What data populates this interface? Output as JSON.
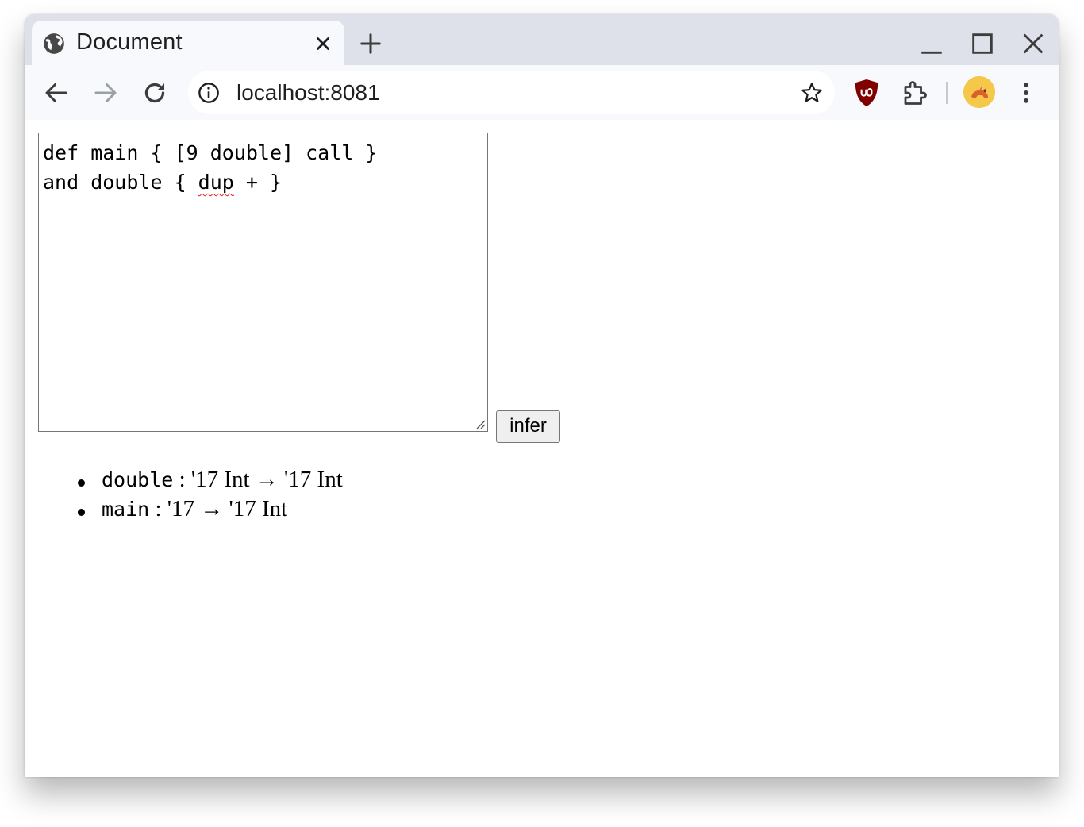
{
  "browser": {
    "tab": {
      "title": "Document",
      "favicon": "globe-icon",
      "close_icon": "close-icon"
    },
    "new_tab_icon": "plus-icon",
    "window_controls": [
      "minimize-icon",
      "maximize-icon",
      "close-icon"
    ],
    "toolbar": {
      "back_icon": "back-arrow-icon",
      "forward_icon": "forward-arrow-icon",
      "reload_icon": "reload-icon",
      "url": "localhost:8081",
      "site_info_icon": "info-icon",
      "bookmark_icon": "star-icon",
      "extensions": [
        "ublock-shield-icon",
        "puzzle-icon"
      ],
      "profile_icon": "avatar",
      "menu_icon": "kebab-menu-icon"
    }
  },
  "editor": {
    "lines": [
      "def main { [9 double] call }",
      "and double { dup + }"
    ],
    "line2_prefix": "and double { ",
    "line2_misspelled": "dup",
    "line2_suffix": " + }"
  },
  "infer_button": {
    "label": "infer"
  },
  "results": [
    {
      "name": "double",
      "type": " : '17 Int → '17 Int"
    },
    {
      "name": "main",
      "type": " : '17 → '17 Int"
    }
  ],
  "colors": {
    "tabstrip": "#dee1e9",
    "toolbar": "#f8f9fc",
    "spellcheck": "#e01b1b",
    "ublock": "#800000"
  }
}
